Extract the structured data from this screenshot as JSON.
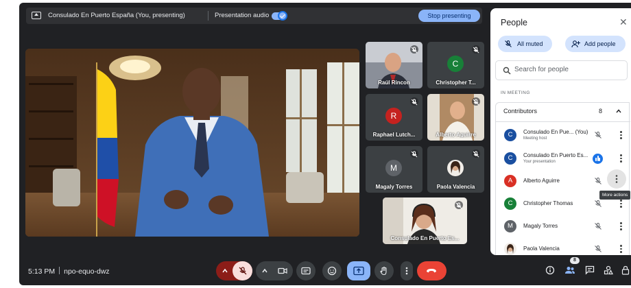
{
  "presenting_bar": {
    "title": "Consulado En Puerto España (You, presenting)",
    "audio_label": "Presentation audio",
    "stop_label": "Stop presenting"
  },
  "tiles": [
    {
      "name": "Raúl Rincon",
      "avatar": "",
      "color": ""
    },
    {
      "name": "Christopher T...",
      "avatar": "C",
      "color": "#188038"
    },
    {
      "name": "Raphael Lutch...",
      "avatar": "R",
      "color": "#c5221f"
    },
    {
      "name": "Alberto Aguirre",
      "avatar": "",
      "color": ""
    },
    {
      "name": "Magaly Torres",
      "avatar": "M",
      "color": "#5f6368"
    },
    {
      "name": "Paola Valencia",
      "avatar": "",
      "color": ""
    },
    {
      "name": "Consulado En Puerto Es...",
      "avatar": "",
      "color": ""
    }
  ],
  "bottom_bar": {
    "time": "5:13 PM",
    "meeting_code": "npo-equo-dwz",
    "participant_count": "8"
  },
  "people_panel": {
    "title": "People",
    "all_muted_label": "All muted",
    "add_people_label": "Add people",
    "search_placeholder": "Search for people",
    "section_label": "IN MEETING",
    "group_label": "Contributors",
    "group_count": "8",
    "tooltip": "More actions",
    "participants": [
      {
        "name": "Consulado En Pue...  (You)",
        "sub": "Meeting host",
        "avatar": "C",
        "color": "#1a4fa0"
      },
      {
        "name": "Consulado En Puerto Es...",
        "sub": "Your presentation",
        "avatar": "C",
        "color": "#1a4fa0"
      },
      {
        "name": "Alberto Aguirre",
        "sub": "",
        "avatar": "A",
        "color": "#d93025"
      },
      {
        "name": "Christopher Thomas",
        "sub": "",
        "avatar": "C",
        "color": "#188038"
      },
      {
        "name": "Magaly Torres",
        "sub": "",
        "avatar": "M",
        "color": "#5f6368"
      },
      {
        "name": "Paola Valencia",
        "sub": "",
        "avatar": "",
        "color": "#c9a98a"
      }
    ]
  },
  "colors": {
    "background": "#202124",
    "accent_blue": "#8ab4f8",
    "end_call_red": "#ea4335"
  }
}
